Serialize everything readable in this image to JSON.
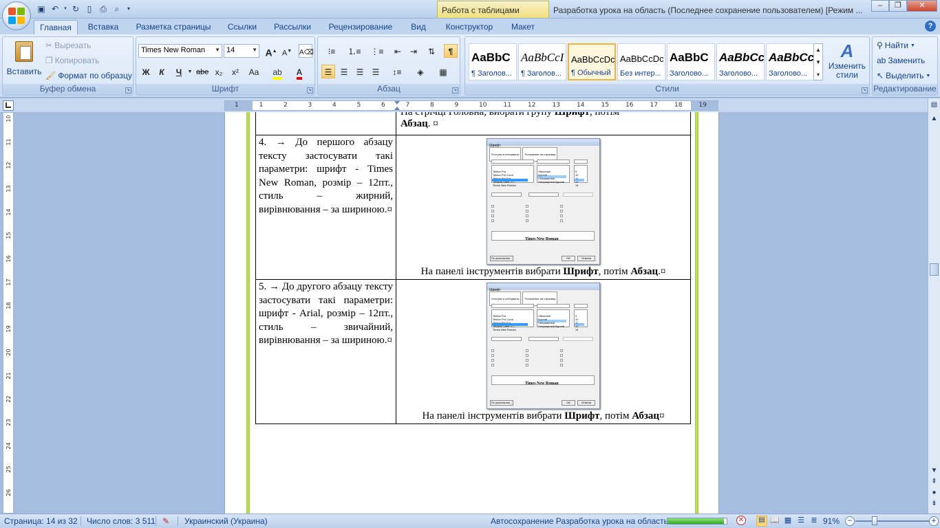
{
  "titlebar": {
    "context_tab": "Работа с таблицами",
    "window_title": "Разработка урока на область (Последнее сохранение пользователем) [Режим ...",
    "qat_icons": [
      "save-icon",
      "undo-icon",
      "redo-icon",
      "new-doc-icon",
      "print-preview-icon",
      "spell-check-icon",
      "customize-qat-icon"
    ]
  },
  "tabs": [
    "Главная",
    "Вставка",
    "Разметка страницы",
    "Ссылки",
    "Рассылки",
    "Рецензирование",
    "Вид",
    "Конструктор",
    "Макет"
  ],
  "ribbon": {
    "clipboard": {
      "title": "Буфер обмена",
      "paste": "Вставить",
      "cut": "Вырезать",
      "copy": "Копировать",
      "format_painter": "Формат по образцу"
    },
    "font": {
      "title": "Шрифт",
      "font_name": "Times New Roman",
      "font_size": "14",
      "bold": "Ж",
      "italic": "К",
      "underline": "Ч",
      "strike": "abe",
      "subscript": "x₂",
      "superscript": "x²",
      "change_case": "Aa",
      "grow": "A",
      "shrink": "A"
    },
    "paragraph": {
      "title": "Абзац",
      "pilcrow": "¶"
    },
    "styles": {
      "title": "Стили",
      "tiles": [
        {
          "sample": "AaBbC",
          "name": "¶ Заголов...",
          "style": "bold"
        },
        {
          "sample": "AaBbCcI",
          "name": "¶ Заголов...",
          "style": "italic"
        },
        {
          "sample": "AaBbCcDc",
          "name": "¶ Обычный",
          "style": "normal",
          "selected": true
        },
        {
          "sample": "AaBbCcDc",
          "name": "Без интер...",
          "style": "normal"
        },
        {
          "sample": "AaBbC",
          "name": "Заголово...",
          "style": "bold"
        },
        {
          "sample": "AaBbCc",
          "name": "Заголово...",
          "style": "bolditalic"
        },
        {
          "sample": "AaBbCcI",
          "name": "Заголово...",
          "style": "bolditalic"
        }
      ],
      "change_styles": "Изменить стили"
    },
    "editing": {
      "title": "Редактирование",
      "find": "Найти",
      "replace": "Заменить",
      "select": "Выделить"
    }
  },
  "ruler": {
    "h_ticks": [
      "1",
      "1",
      "2",
      "3",
      "4",
      "5",
      "6",
      "7",
      "8",
      "9",
      "10",
      "11",
      "12",
      "13",
      "14",
      "15",
      "16",
      "17",
      "18",
      "19"
    ],
    "v_ticks": [
      "10",
      "11",
      "12",
      "13",
      "14",
      "15",
      "16",
      "17",
      "18",
      "19",
      "20",
      "21",
      "22",
      "23",
      "24",
      "25",
      "26"
    ]
  },
  "document": {
    "top_fragment_line1": "На стрічці Головна, вибрати групу ",
    "top_fragment_bold1": "Шрифт",
    "top_fragment_line1_end": ", потім",
    "top_fragment_bold2": "Абзац",
    "top_fragment_end": ". ¤",
    "rows": [
      {
        "left": "4. → До першого абзацу тексту застосувати такі параметри: шрифт - Times New Roman, розмір – 12пт., стиль – жирний, вирівнювання – за шириною.¤",
        "caption_pre": "На панелі інструментів вибрати ",
        "caption_b1": "Шрифт",
        "caption_mid": ", потім ",
        "caption_b2": "Абзац",
        "caption_end": ".¤"
      },
      {
        "left": "5. → До другого абзацу тексту застосувати такі параметри: шрифт - Arial, розмір – 12пт., стиль – звичайний, вирівнювання – за шириною.¤",
        "caption_pre": "На панелі інструментів вибрати ",
        "caption_b1": "Шрифт",
        "caption_mid": ", потім ",
        "caption_b2": "Абзац",
        "caption_end": "¤"
      }
    ],
    "dialog": {
      "title": "Шрифт",
      "tab1": "Отступы и интервалы",
      "tab2": "Положение на странице",
      "font_label": "Шрифт:",
      "style_label": "Начертание:",
      "size_label": "Размер:",
      "font_value": "Times New Roman",
      "style_value": "Полужирный",
      "size_value": "14",
      "fonts": [
        "Tekton Pro",
        "Tekton Pro Cond",
        "Tekton Pro Ext",
        "Tempus Sans ITC",
        "Times New Roman"
      ],
      "styles": [
        "Обычный",
        "Курсив",
        "Полужирный",
        "Полужирный Курсив"
      ],
      "sizes": [
        "9",
        "10",
        "11",
        "12",
        "14"
      ],
      "sample_label": "Образец",
      "sample_text": "Times New Roman",
      "ok": "ОК",
      "cancel": "Отмена",
      "default": "По умолчанию..."
    }
  },
  "status": {
    "page": "Страница: 14 из 32",
    "words": "Число слов: 3 511",
    "language": "Украинский (Украина)",
    "autosave": "Автосохранение Разработка урока на область:",
    "autosave_progress": 0.95,
    "zoom": "91%"
  }
}
